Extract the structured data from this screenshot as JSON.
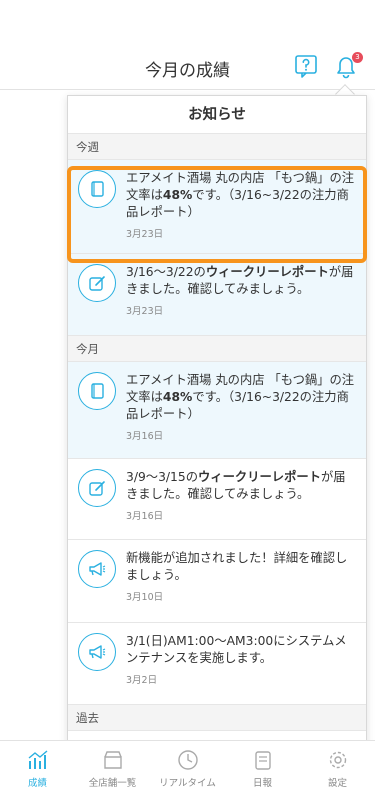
{
  "header": {
    "title": "今月の成績",
    "badge_count": "3"
  },
  "panel": {
    "title": "お知らせ",
    "sections": {
      "this_week": "今週",
      "this_month": "今月",
      "past": "過去"
    },
    "items": [
      {
        "icon": "document-icon",
        "pre": "エアメイト酒場 丸の内店 「もつ鍋」の注文率は",
        "bold": "48%",
        "post": "です。（3/16~3/22の注力商品レポート）",
        "date": "3月23日"
      },
      {
        "icon": "edit-icon",
        "pre": "3/16〜3/22の",
        "bold": "ウィークリーレポート",
        "post": "が届きました。確認してみましょう。",
        "date": "3月23日"
      },
      {
        "icon": "document-icon",
        "pre": "エアメイト酒場 丸の内店 「もつ鍋」の注文率は",
        "bold": "48%",
        "post": "です。（3/16~3/22の注力商品レポート）",
        "date": "3月16日"
      },
      {
        "icon": "edit-icon",
        "pre": "3/9〜3/15の",
        "bold": "ウィークリーレポート",
        "post": "が届きました。確認してみましょう。",
        "date": "3月16日"
      },
      {
        "icon": "megaphone-icon",
        "pre": "新機能が追加されました！詳細を確認しましょう。",
        "bold": "",
        "post": "",
        "date": "3月10日"
      },
      {
        "icon": "megaphone-icon",
        "pre": "3/1(日)AM1:00〜AM3:00にシステムメンテナンスを実施します。",
        "bold": "",
        "post": "",
        "date": "3月2日"
      }
    ]
  },
  "tabbar": {
    "tabs": [
      {
        "label": "成績",
        "icon": "chart-icon",
        "active": true
      },
      {
        "label": "全店舗一覧",
        "icon": "store-icon",
        "active": false
      },
      {
        "label": "リアルタイム",
        "icon": "clock-icon",
        "active": false
      },
      {
        "label": "日報",
        "icon": "report-icon",
        "active": false
      },
      {
        "label": "設定",
        "icon": "gear-icon",
        "active": false
      }
    ]
  },
  "colors": {
    "accent": "#2ab0e0",
    "highlight": "#f7941d",
    "badge": "#e74c5b",
    "unread_bg": "#eef8fd"
  }
}
